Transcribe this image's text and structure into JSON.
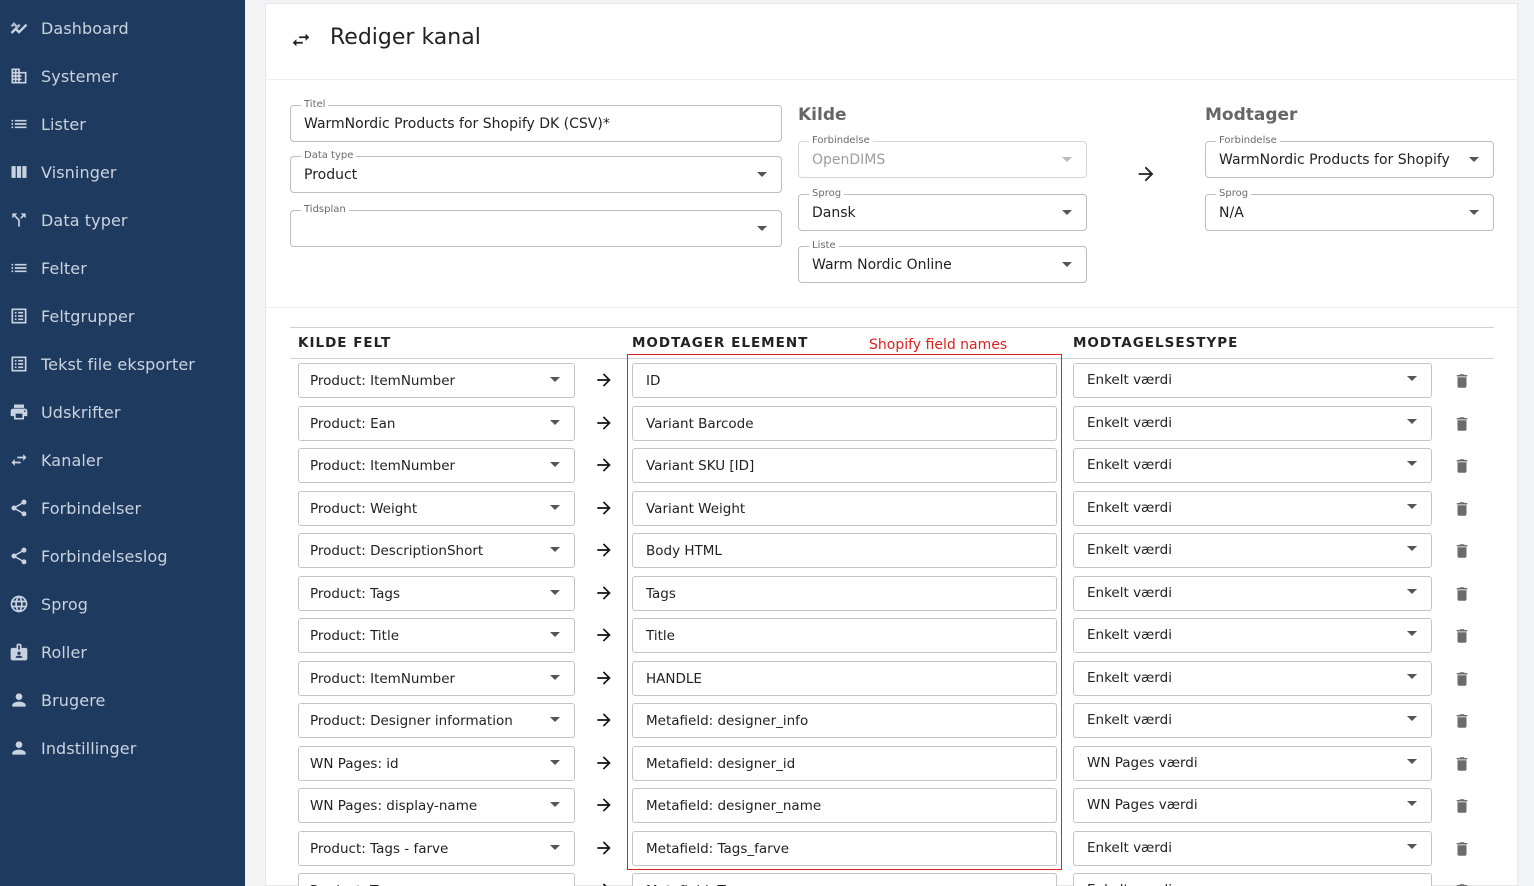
{
  "sidebar": {
    "items": [
      {
        "label": "Dashboard",
        "icon": "dashboard-icon"
      },
      {
        "label": "Systemer",
        "icon": "building-icon"
      },
      {
        "label": "Lister",
        "icon": "list-icon"
      },
      {
        "label": "Visninger",
        "icon": "columns-icon"
      },
      {
        "label": "Data typer",
        "icon": "fork-icon"
      },
      {
        "label": "Felter",
        "icon": "list-icon"
      },
      {
        "label": "Feltgrupper",
        "icon": "list-box-icon"
      },
      {
        "label": "Tekst file eksporter",
        "icon": "list-box-icon"
      },
      {
        "label": "Udskrifter",
        "icon": "printer-icon"
      },
      {
        "label": "Kanaler",
        "icon": "swap-arrows-icon"
      },
      {
        "label": "Forbindelser",
        "icon": "share-icon"
      },
      {
        "label": "Forbindelseslog",
        "icon": "share-icon"
      },
      {
        "label": "Sprog",
        "icon": "globe-icon"
      },
      {
        "label": "Roller",
        "icon": "badge-icon"
      },
      {
        "label": "Brugere",
        "icon": "person-icon"
      },
      {
        "label": "Indstillinger",
        "icon": "person-icon"
      }
    ]
  },
  "header": {
    "title": "Rediger kanal",
    "icon": "swap-arrows-icon"
  },
  "form": {
    "titel": {
      "label": "Titel",
      "value": "WarmNordic Products for Shopify DK (CSV)*"
    },
    "datatype": {
      "label": "Data type",
      "value": "Product"
    },
    "tidsplan": {
      "label": "Tidsplan",
      "value": ""
    }
  },
  "kilde": {
    "heading": "Kilde",
    "forbindelse": {
      "label": "Forbindelse",
      "value": "OpenDIMS"
    },
    "sprog": {
      "label": "Sprog",
      "value": "Dansk"
    },
    "liste": {
      "label": "Liste",
      "value": "Warm Nordic Online"
    }
  },
  "modtager": {
    "heading": "Modtager",
    "forbindelse": {
      "label": "Forbindelse",
      "value": "WarmNordic Products for Shopify"
    },
    "sprog": {
      "label": "Sprog",
      "value": "N/A"
    }
  },
  "table": {
    "headers": {
      "source": "KILDE FELT",
      "target": "MODTAGER ELEMENT",
      "type": "MODTAGELSESTYPE"
    },
    "annotation": "Shopify field names",
    "rows": [
      {
        "source": "Product: ItemNumber",
        "target": "ID",
        "type": "Enkelt værdi"
      },
      {
        "source": "Product: Ean",
        "target": "Variant Barcode",
        "type": "Enkelt værdi"
      },
      {
        "source": "Product: ItemNumber",
        "target": "Variant SKU [ID]",
        "type": "Enkelt værdi"
      },
      {
        "source": "Product: Weight",
        "target": "Variant Weight",
        "type": "Enkelt værdi"
      },
      {
        "source": "Product: DescriptionShort",
        "target": "Body HTML",
        "type": "Enkelt værdi"
      },
      {
        "source": "Product: Tags",
        "target": "Tags",
        "type": "Enkelt værdi"
      },
      {
        "source": "Product: Title",
        "target": "Title",
        "type": "Enkelt værdi"
      },
      {
        "source": "Product: ItemNumber",
        "target": "HANDLE",
        "type": "Enkelt værdi"
      },
      {
        "source": "Product: Designer information",
        "target": "Metafield: designer_info",
        "type": "Enkelt værdi"
      },
      {
        "source": "WN Pages: id",
        "target": "Metafield: designer_id",
        "type": "WN Pages værdi"
      },
      {
        "source": "WN Pages: display-name",
        "target": "Metafield: designer_name",
        "type": "WN Pages værdi"
      },
      {
        "source": "Product: Tags - farve",
        "target": "Metafield: Tags_farve",
        "type": "Enkelt værdi"
      },
      {
        "source": "Product: Tags",
        "target": "Metafield: Tags",
        "type": "Enkelt værdi"
      }
    ]
  },
  "colors": {
    "sidebar_bg": "#1f3a5f",
    "sidebar_text": "#c9d3e0",
    "annotation": "#e02020"
  }
}
